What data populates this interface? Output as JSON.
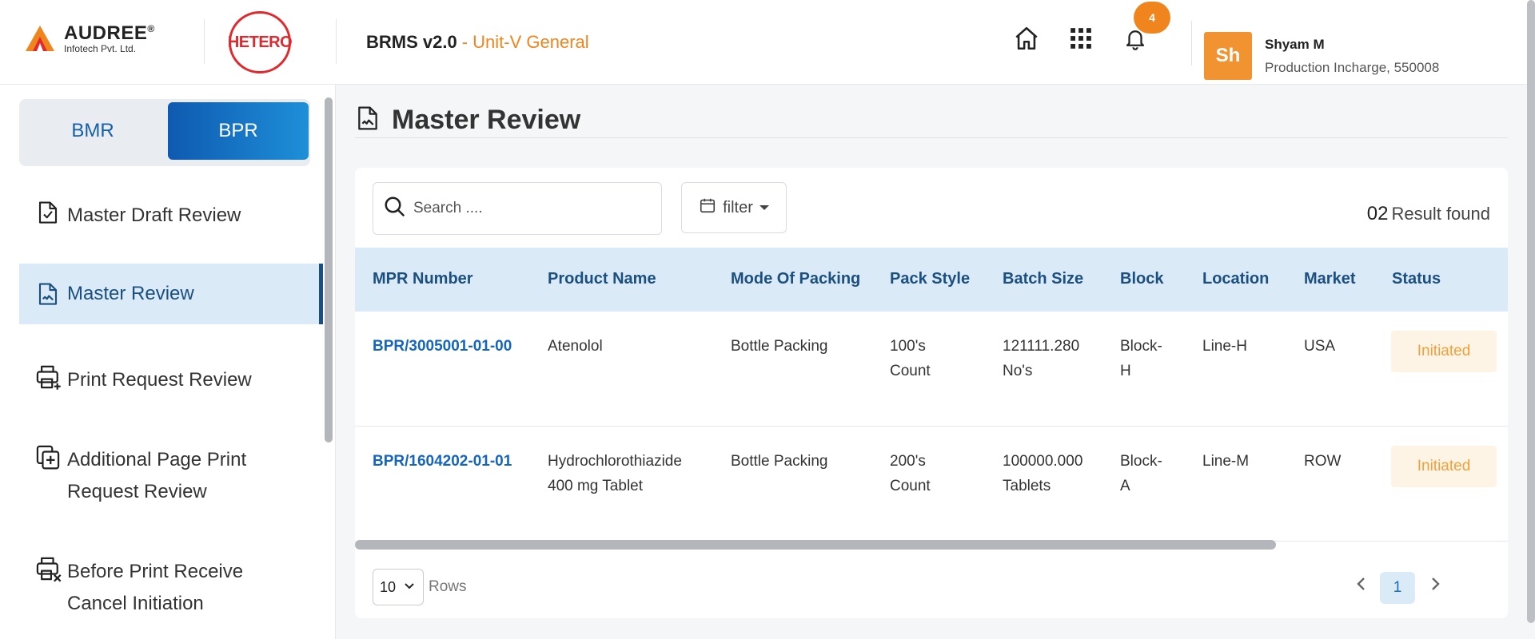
{
  "header": {
    "audree": {
      "name": "AUDREE",
      "registered": "®",
      "sub": "Infotech Pvt. Ltd."
    },
    "hetero_logo": "HETERO",
    "app_title": "BRMS v2.0",
    "unit_title": "- Unit-V General",
    "notifications_count": "4",
    "user": {
      "initials": "Sh",
      "name": "Shyam M",
      "role": "Production Incharge, 550008"
    },
    "icons": [
      "home-icon",
      "apps-grid-icon",
      "bell-icon"
    ]
  },
  "sidebar": {
    "toggle": {
      "bmr": "BMR",
      "bpr": "BPR",
      "active": "BPR"
    },
    "items": [
      {
        "label": "Master Draft Review",
        "icon": "document-check-icon",
        "active": false
      },
      {
        "label": "Master Review",
        "icon": "document-sign-icon",
        "active": true
      },
      {
        "label": "Print Request Review",
        "icon": "printer-plus-icon",
        "active": false
      },
      {
        "label_line1": "Additional Page Print",
        "label_line2": "Request Review",
        "icon": "page-add-icon",
        "active": false
      },
      {
        "label_line1": "Before Print Receive",
        "label_line2": "Cancel Initiation",
        "icon": "printer-cancel-icon",
        "active": false
      }
    ]
  },
  "main": {
    "title": "Master Review",
    "search": {
      "placeholder": "Search ...."
    },
    "filter_label": "filter",
    "result_count": "02",
    "result_text": "Result found",
    "columns": [
      "MPR Number",
      "Product Name",
      "Mode Of Packing",
      "Pack Style",
      "Batch Size",
      "Block",
      "Location",
      "Market",
      "Status"
    ],
    "rows": [
      {
        "mpr": "BPR/3005001-01-00",
        "product": "Atenolol",
        "product2": "",
        "mode": "Bottle Packing",
        "pack1": "100's",
        "pack2": "Count",
        "batch1": "121111.280",
        "batch2": "No's",
        "block1": "Block-",
        "block2": "H",
        "location": "Line-H",
        "market": "USA",
        "status": "Initiated"
      },
      {
        "mpr": "BPR/1604202-01-01",
        "product": "Hydrochlorothiazide",
        "product2": "400 mg Tablet",
        "mode": "Bottle Packing",
        "pack1": "200's",
        "pack2": "Count",
        "batch1": "100000.000",
        "batch2": "Tablets",
        "block1": "Block-",
        "block2": "A",
        "location": "Line-M",
        "market": "ROW",
        "status": "Initiated"
      }
    ],
    "rows_per_page": "10",
    "rows_label": "Rows",
    "current_page": "1"
  },
  "colors": {
    "accent_orange": "#f0851e",
    "primary_blue": "#1560a8",
    "table_header_bg": "#dbeaf7",
    "status_text": "#f0a13a",
    "hetero_red": "#e0282d"
  }
}
